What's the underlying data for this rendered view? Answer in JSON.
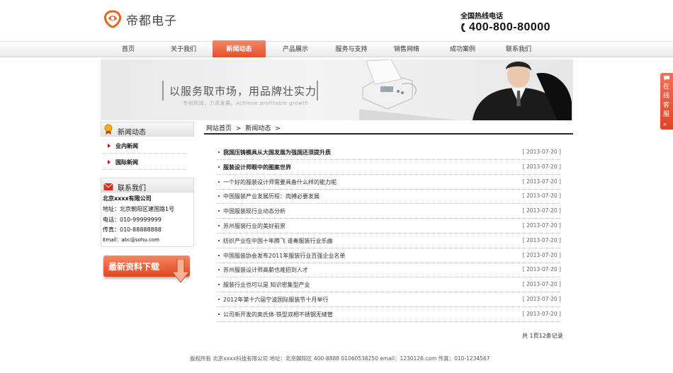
{
  "header": {
    "logo_text": "帝都电子",
    "hotline_label": "全国热线电话",
    "hotline_number": "400-800-80000"
  },
  "nav": {
    "items": [
      {
        "label": "首页"
      },
      {
        "label": "关于我们"
      },
      {
        "label": "新闻动态",
        "active": true
      },
      {
        "label": "产品展示"
      },
      {
        "label": "服务与支持"
      },
      {
        "label": "销售网络"
      },
      {
        "label": "成功案例"
      },
      {
        "label": "联系我们"
      }
    ]
  },
  "banner": {
    "slogan": "以服务取市场，用品牌壮实力",
    "subtitle": "专创利润，力求发展。Achieve profitable growth"
  },
  "sidebar": {
    "news_title": "新闻动态",
    "news_items": [
      {
        "label": "业内新闻"
      },
      {
        "label": "国际新闻"
      }
    ],
    "contact_title": "联系我们",
    "contact_lines": [
      "北京xxxx有限公司",
      "地址：北京朝阳区建国路1号",
      "电话：010-99999999",
      "传真：010-88888888",
      "Email：abc@sohu.com"
    ],
    "download_label": "最新资料下载"
  },
  "breadcrumb": {
    "home": "网站首页",
    "sep": ">",
    "current": "新闻动态",
    "tail": ">"
  },
  "news": {
    "rows": [
      {
        "title": "我国压铸模具从大国发展为强国还须提升质",
        "date": "[ 2013-07-20 ]",
        "bold": true
      },
      {
        "title": "服装设计师眼中的图案世界",
        "date": "[ 2013-07-20 ]",
        "bold": true
      },
      {
        "title": "一个好的服装设计师需要具备什么样的能力呢",
        "date": "[ 2013-07-20 ]",
        "bold": false
      },
      {
        "title": "中国服装产业发展历程：肉搏必要发展",
        "date": "[ 2013-07-20 ]",
        "bold": false
      },
      {
        "title": "中国服装现行业动态分析",
        "date": "[ 2013-07-20 ]",
        "bold": false
      },
      {
        "title": "苏州服装行业的美好前景",
        "date": "[ 2013-07-20 ]",
        "bold": false
      },
      {
        "title": "纺织产业在中国十年腾飞 谁奏服装行业乐曲",
        "date": "[ 2013-07-20 ]",
        "bold": false
      },
      {
        "title": "中国服装协会发布2011年服装行业百强企业名单",
        "date": "[ 2013-07-20 ]",
        "bold": false
      },
      {
        "title": "苏州服装设计师高薪也难招到人才",
        "date": "[ 2013-07-20 ]",
        "bold": false
      },
      {
        "title": "服装行业也可以是 知识密集型产业",
        "date": "[ 2013-07-20 ]",
        "bold": false
      },
      {
        "title": "2012年第十六届宁波国际服装节十月举行",
        "date": "[ 2013-07-20 ]",
        "bold": false
      },
      {
        "title": "公司新开发的奥氏体-铁型双相不锈钢无缝管",
        "date": "[ 2013-07-20 ]",
        "bold": false
      }
    ],
    "pager": "共 1页12条记录"
  },
  "footer": {
    "text": "版权所有 北京xxxx科技有限公司 地址：北京朝阳区 400-8888 01060538250 email：1230126.com 传真：010-1234567"
  },
  "online_service": {
    "label": "在线客服"
  },
  "colors": {
    "accent": "#e4502c",
    "nav_bg": "#eaeaea"
  }
}
